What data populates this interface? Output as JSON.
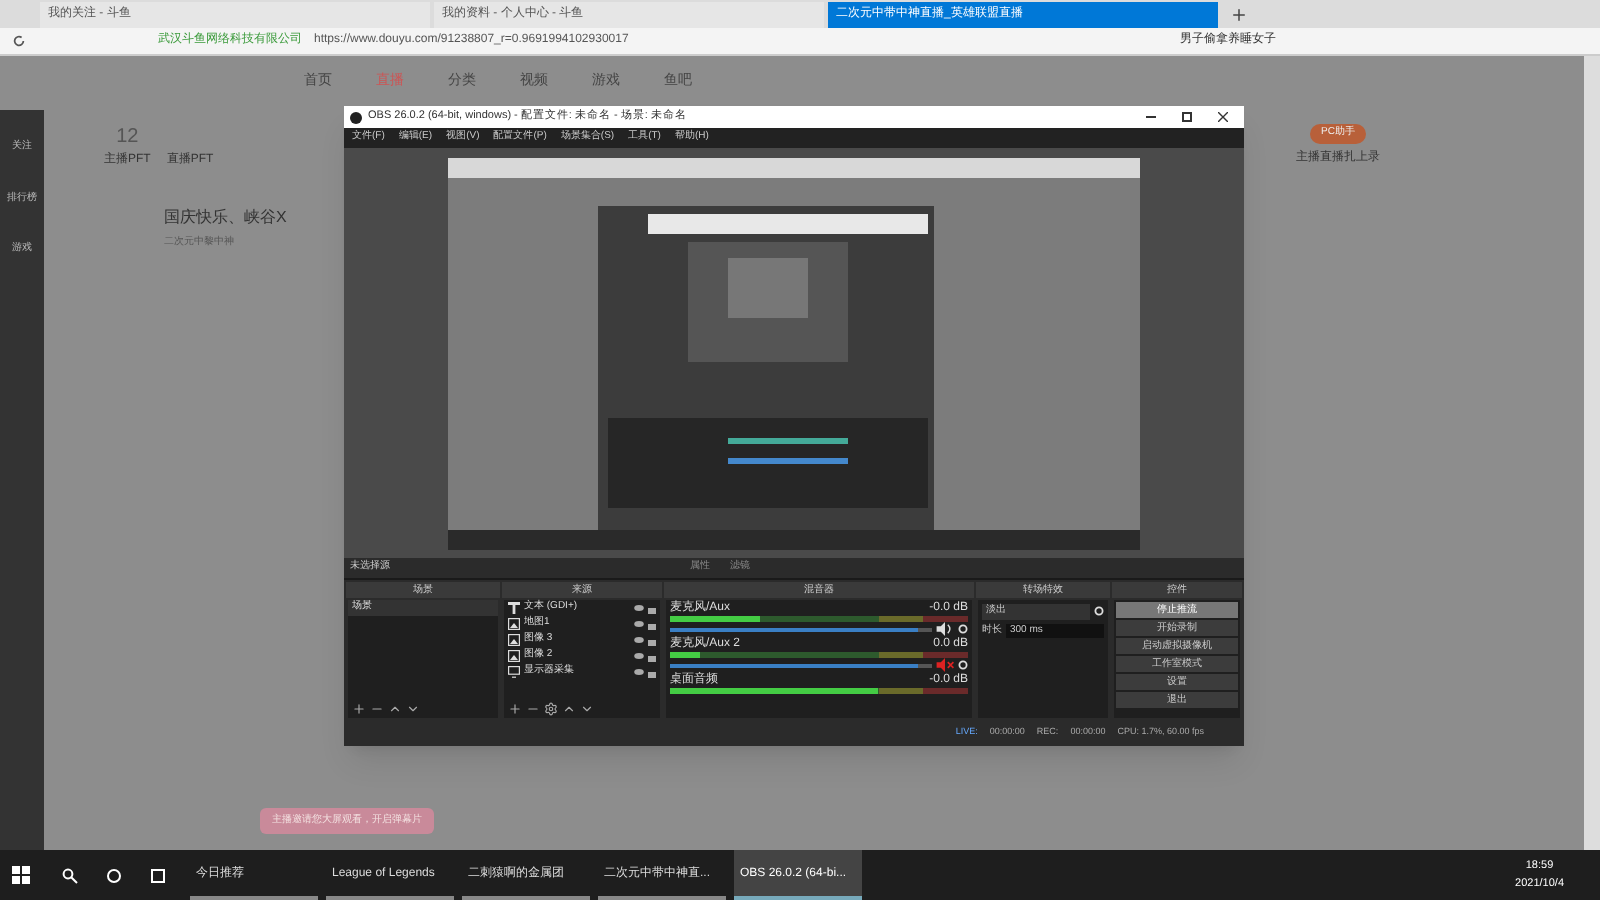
{
  "browser": {
    "tabs": [
      {
        "label": "我的关注 - 斗鱼",
        "selected": false
      },
      {
        "label": "我的资料 - 个人中心 - 斗鱼",
        "selected": false
      },
      {
        "label": "二次元中带中神直播_英雄联盟直播",
        "selected": true
      }
    ],
    "site_name": "武汉斗鱼网络科技有限公司",
    "url": "https://www.douyu.com/91238807_r=0.9691994102930017",
    "search": "男子偷拿养睡女子"
  },
  "page": {
    "nav": [
      {
        "label": "首页",
        "selected": false
      },
      {
        "label": "直播",
        "selected": true
      },
      {
        "label": "分类",
        "selected": false
      },
      {
        "label": "视频",
        "selected": false
      },
      {
        "label": "游戏",
        "selected": false
      },
      {
        "label": "鱼吧",
        "selected": false
      }
    ],
    "sidebar": [
      "关注",
      "排行榜",
      "游戏"
    ],
    "follow_count": "12",
    "follow_label": "主播PFT",
    "live_badge": "直播PFT",
    "headline": "国庆快乐、峡谷X",
    "streamer": "二次元中黎中神",
    "pc_button": "PC助手",
    "pc_caption": "主播直播扎上录"
  },
  "obs": {
    "title": "OBS 26.0.2 (64-bit, windows) - 配置文件: 未命名 - 场景: 未命名",
    "menu": [
      "文件(F)",
      "编辑(E)",
      "视图(V)",
      "配置文件(P)",
      "场景集合(S)",
      "工具(T)",
      "帮助(H)"
    ],
    "no_source": "未选择源",
    "properties": "属性",
    "filters": "滤镜",
    "scenes": {
      "title": "场景",
      "items": [
        "场景"
      ]
    },
    "sources": {
      "title": "来源",
      "items": [
        {
          "kind": "text",
          "label": "文本 (GDI+)"
        },
        {
          "kind": "image",
          "label": "地图1"
        },
        {
          "kind": "image",
          "label": "图像 3"
        },
        {
          "kind": "image",
          "label": "图像 2"
        },
        {
          "kind": "monitor",
          "label": "显示器采集"
        }
      ]
    },
    "mixer": {
      "title": "混音器",
      "channels": [
        {
          "name": "麦克风/Aux",
          "reading": "-0.0 dB",
          "level": 0.3,
          "fader": {
            "level": 0.95
          },
          "muted": false
        },
        {
          "name": "麦克风/Aux 2",
          "reading": "0.0 dB",
          "level": 0.1,
          "fader": {
            "level": 0.95
          },
          "muted": true
        },
        {
          "name": "桌面音频",
          "reading": "-0.0 dB",
          "level": 0.7
        }
      ]
    },
    "transitions": {
      "title": "转场特效",
      "type": "淡出",
      "duration_label": "时长",
      "duration": "300 ms"
    },
    "controls": {
      "title": "控件",
      "buttons": [
        {
          "label": "停止推流",
          "selected": true
        },
        {
          "label": "开始录制",
          "selected": false
        },
        {
          "label": "启动虚拟摄像机",
          "selected": false
        },
        {
          "label": "工作室模式",
          "selected": false
        },
        {
          "label": "设置",
          "selected": false
        },
        {
          "label": "退出",
          "selected": false
        }
      ]
    },
    "status": {
      "live": "LIVE:",
      "live_time": "00:00:00",
      "rec": "REC:",
      "rec_time": "00:00:00",
      "cpu": "CPU: 1.7%, 60.00 fps"
    }
  },
  "toast": "主播邀请您大屏观看，开启弹幕片",
  "taskbar": {
    "items": [
      {
        "label": "今日推荐",
        "selected": false
      },
      {
        "label": "League of Legends",
        "selected": false
      },
      {
        "label": "二刺猿啊的金属团",
        "selected": false
      },
      {
        "label": "二次元中带中神直...",
        "selected": false
      },
      {
        "label": "OBS 26.0.2 (64-bi...",
        "selected": true
      }
    ],
    "time": "18:59",
    "date": "2021/10/4"
  }
}
